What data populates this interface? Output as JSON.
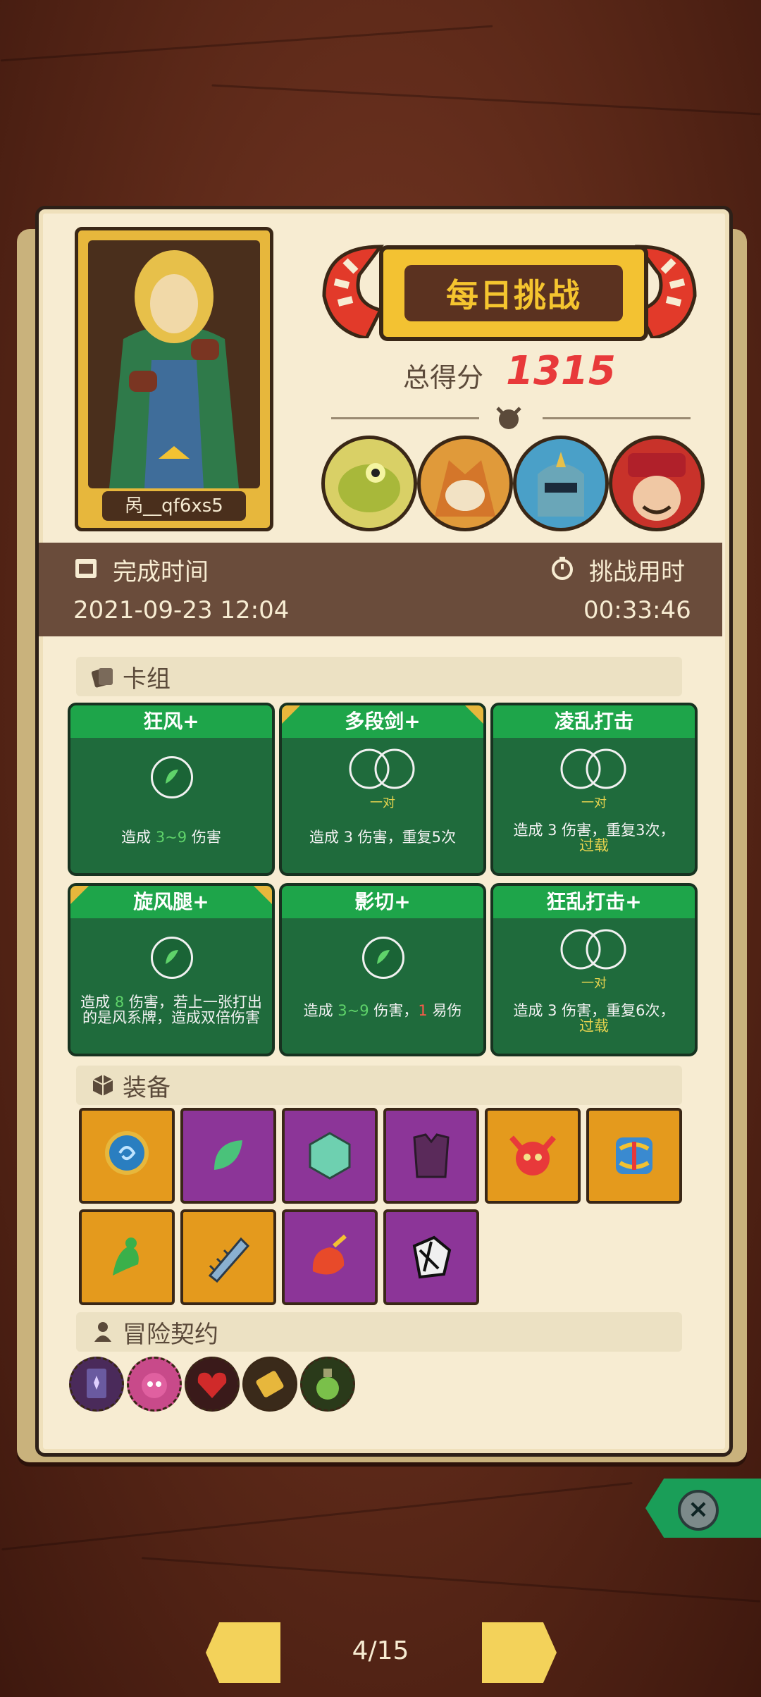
{
  "header": {
    "title": "每日挑战",
    "score_label": "总得分",
    "score_value": "1315"
  },
  "hero": {
    "name": "呙__qf6xs5"
  },
  "bosses": [
    "crocodile-boss",
    "fox-boss",
    "knight-boss",
    "jester-boss"
  ],
  "stats": {
    "finish_label": "完成时间",
    "finish_value": "2021-09-23 12:04",
    "duration_label": "挑战用时",
    "duration_value": "00:33:46"
  },
  "deck": {
    "title": "卡组",
    "cards": [
      {
        "name": "狂风+",
        "pair": "",
        "desc_parts": [
          "造成 ",
          "3~9",
          " 伤害"
        ]
      },
      {
        "name": "多段剑+",
        "pair": "一对",
        "desc_parts": [
          "造成 ",
          "3 伤害，重复5次"
        ]
      },
      {
        "name": "凌乱打击",
        "pair": "一对",
        "desc_parts": [
          "造成 ",
          "3 伤害，重复3次，",
          "过载"
        ]
      },
      {
        "name": "旋风腿+",
        "pair": "",
        "desc_parts": [
          "造成 ",
          "8",
          " 伤害，若上一张打出的是风系牌，造成双倍伤害"
        ]
      },
      {
        "name": "影切+",
        "pair": "",
        "desc_parts": [
          "造成 ",
          "3~9",
          " 伤害，",
          "1",
          " 易伤"
        ]
      },
      {
        "name": "狂乱打击+",
        "pair": "一对",
        "desc_parts": [
          "造成 ",
          "3 伤害，重复6次，",
          "过载"
        ]
      }
    ]
  },
  "equipment": {
    "title": "装备",
    "items": [
      {
        "icon": "blue-swirl-amulet-icon",
        "rarity": "orange"
      },
      {
        "icon": "green-feather-icon",
        "rarity": "purple"
      },
      {
        "icon": "crystal-dice-icon",
        "rarity": "purple"
      },
      {
        "icon": "purple-armor-icon",
        "rarity": "purple"
      },
      {
        "icon": "demon-skull-icon",
        "rarity": "orange"
      },
      {
        "icon": "rainbow-cube-icon",
        "rarity": "orange"
      },
      {
        "icon": "green-spirit-icon",
        "rarity": "orange"
      },
      {
        "icon": "serrated-blade-icon",
        "rarity": "orange"
      },
      {
        "icon": "fire-dragon-icon",
        "rarity": "purple"
      },
      {
        "icon": "shattered-dice-icon",
        "rarity": "purple"
      }
    ]
  },
  "contracts": {
    "title": "冒险契约",
    "items": [
      "tarot-card-icon",
      "pink-demon-icon",
      "red-heart-icon",
      "gold-ticket-icon",
      "potion-icon"
    ]
  },
  "pager": {
    "current": "4/15"
  },
  "colors": {
    "score": "#e8393a",
    "card_green": "#1f6b3c",
    "card_header": "#1ea54a",
    "banner": "#f3c232"
  }
}
